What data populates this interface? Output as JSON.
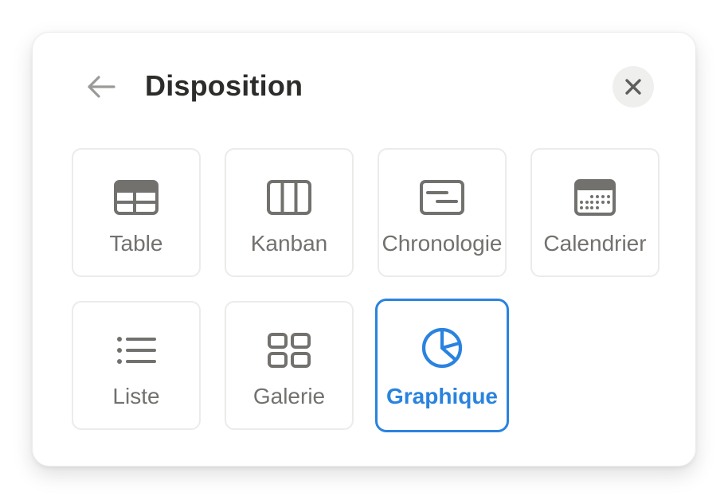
{
  "header": {
    "title": "Disposition",
    "back_icon": "arrow-left-icon",
    "close_icon": "close-icon"
  },
  "layouts": [
    {
      "label": "Table",
      "icon": "table-icon",
      "selected": false
    },
    {
      "label": "Kanban",
      "icon": "board-columns-icon",
      "selected": false
    },
    {
      "label": "Chronologie",
      "icon": "timeline-icon",
      "selected": false
    },
    {
      "label": "Calendrier",
      "icon": "calendar-icon",
      "selected": false
    },
    {
      "label": "Liste",
      "icon": "list-icon",
      "selected": false
    },
    {
      "label": "Galerie",
      "icon": "gallery-grid-icon",
      "selected": false
    },
    {
      "label": "Graphique",
      "icon": "pie-chart-icon",
      "selected": true
    }
  ],
  "colors": {
    "accent": "#2a83de",
    "icon": "#72716e",
    "label": "#72716e",
    "title": "#2c2c2a",
    "close_bg": "#efefed"
  }
}
